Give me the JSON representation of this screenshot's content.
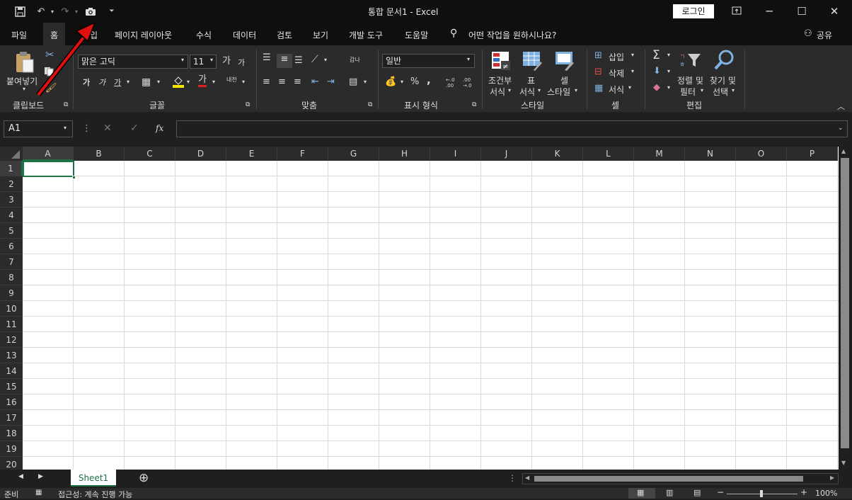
{
  "titlebar": {
    "title": "통합 문서1  -  Excel",
    "login": "로그인",
    "save_icon": "save-icon",
    "undo_icon": "undo-icon",
    "redo_icon": "redo-icon",
    "camera_icon": "camera-icon",
    "customize_icon": "chevron-down-icon"
  },
  "menu": {
    "file": "파일",
    "home": "홈",
    "insert": "삽입",
    "page_layout": "페이지 레이아웃",
    "formulas": "수식",
    "data": "데이터",
    "review": "검토",
    "view": "보기",
    "developer": "개발 도구",
    "help": "도움말",
    "tell_me": "어떤 작업을 원하시나요?",
    "share": "공유"
  },
  "ribbon": {
    "clipboard": {
      "paste": "붙여넣기",
      "label": "클립보드"
    },
    "font": {
      "name": "맑은 고딕",
      "size": "11",
      "grow": "가",
      "shrink": "가",
      "bold": "가",
      "italic": "가",
      "underline": "가",
      "font_color": "가",
      "phonetic": "내천",
      "label": "글꼴"
    },
    "alignment": {
      "wrap": "갑나",
      "label": "맞춤"
    },
    "number": {
      "format": "일반",
      "percent": "%",
      "comma": ",",
      "inc": "←.0 .00",
      "dec": ".00 →.0",
      "label": "표시 형식"
    },
    "styles": {
      "cond1": "조건부",
      "cond2": "서식",
      "table1": "표",
      "table2": "서식",
      "cell1": "셀",
      "cell2": "스타일",
      "label": "스타일"
    },
    "cells": {
      "insert": "삽입",
      "delete": "삭제",
      "format": "서식",
      "label": "셀"
    },
    "editing": {
      "sort1": "정렬 및",
      "sort2": "필터",
      "find1": "찾기 및",
      "find2": "선택",
      "label": "편집"
    }
  },
  "formula": {
    "namebox": "A1",
    "fx": "fx"
  },
  "grid": {
    "columns": [
      "A",
      "B",
      "C",
      "D",
      "E",
      "F",
      "G",
      "H",
      "I",
      "J",
      "K",
      "L",
      "M",
      "N",
      "O",
      "P"
    ],
    "rows": [
      "1",
      "2",
      "3",
      "4",
      "5",
      "6",
      "7",
      "8",
      "9",
      "10",
      "11",
      "12",
      "13",
      "14",
      "15",
      "16",
      "17",
      "18",
      "19",
      "20"
    ],
    "selected": "A1"
  },
  "sheets": {
    "tab": "Sheet1"
  },
  "status": {
    "ready": "준비",
    "accessibility": "접근성: 계속 진행 가능",
    "zoom": "100%"
  },
  "colors": {
    "accent": "#1e7145",
    "arrow": "#e01010"
  }
}
